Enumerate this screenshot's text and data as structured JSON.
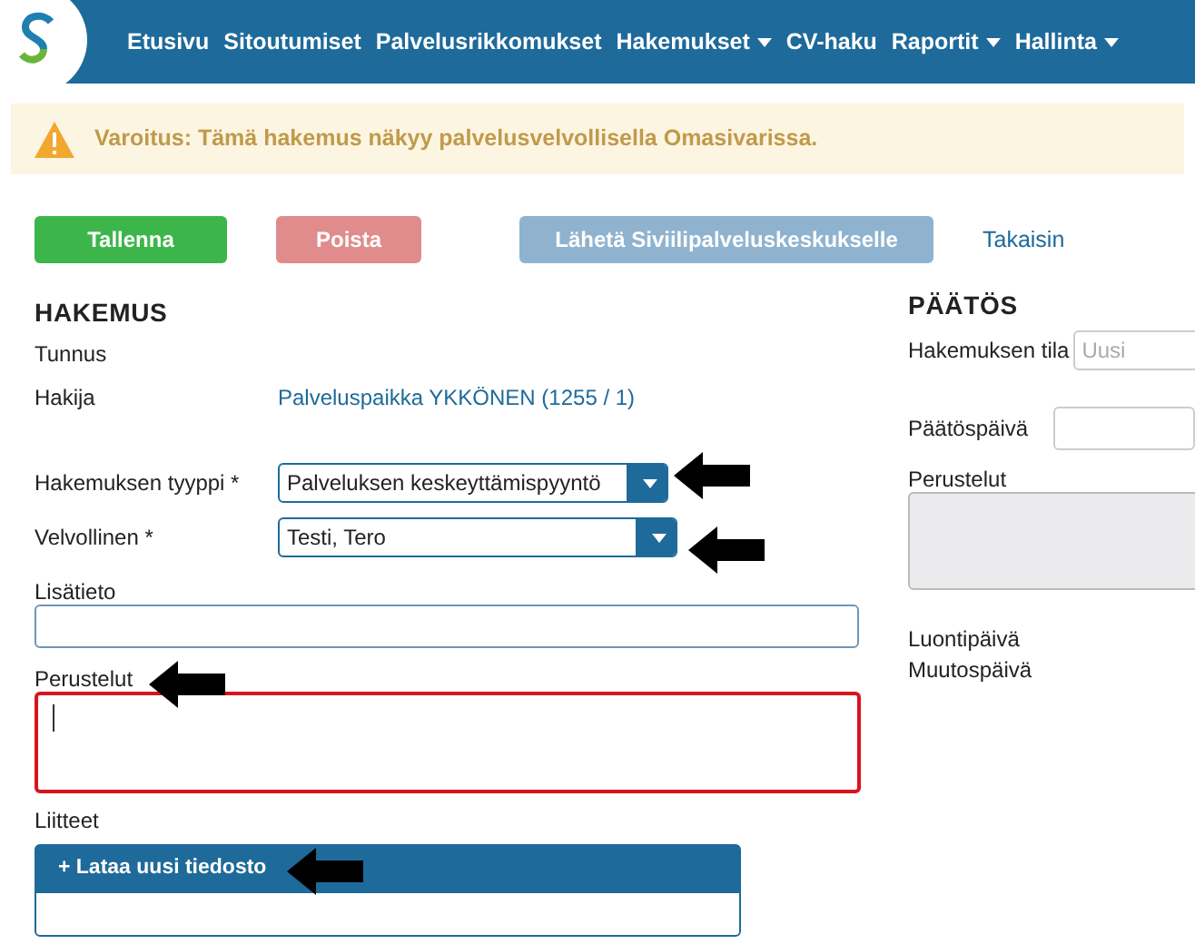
{
  "nav": [
    {
      "label": "Etusivu",
      "dropdown": false
    },
    {
      "label": "Sitoutumiset",
      "dropdown": false
    },
    {
      "label": "Palvelusrikkomukset",
      "dropdown": false
    },
    {
      "label": "Hakemukset",
      "dropdown": true
    },
    {
      "label": "CV-haku",
      "dropdown": false
    },
    {
      "label": "Raportit",
      "dropdown": true
    },
    {
      "label": "Hallinta",
      "dropdown": true
    }
  ],
  "warning": "Varoitus: Tämä hakemus näkyy palvelusvelvollisella Omasivarissa.",
  "actions": [
    {
      "label": "Tallenna",
      "kind": "save",
      "disabled": false
    },
    {
      "label": "Poista",
      "kind": "delete",
      "disabled": true
    },
    {
      "label": "Lähetä Siviilipalveluskeskukselle",
      "kind": "send",
      "disabled": true
    },
    {
      "label": "Takaisin",
      "kind": "link"
    }
  ],
  "application": {
    "title": "HAKEMUS",
    "id_label": "Tunnus",
    "applicant_label": "Hakija",
    "applicant": "Palveluspaikka YKKÖNEN (1255 / 1)",
    "type_label": "Hakemuksen tyyppi *",
    "type_value": "Palveluksen keskeyttämispyyntö",
    "person_label": "Velvollinen *",
    "person_value": "Testi, Tero",
    "info_label": "Lisätieto",
    "reason_label": "Perustelut",
    "reason_invalid": true,
    "attachments_label": "Liitteet",
    "upload": "+ Lataa uusi tiedosto"
  },
  "decision": {
    "title": "PÄÄTÖS",
    "status_label": "Hakemuksen tila",
    "status_placeholder": "Uusi",
    "date_label": "Päätöspäivä",
    "reason_label": "Perustelut",
    "created_label": "Luontipäivä",
    "modified_label": "Muutospäivä"
  }
}
